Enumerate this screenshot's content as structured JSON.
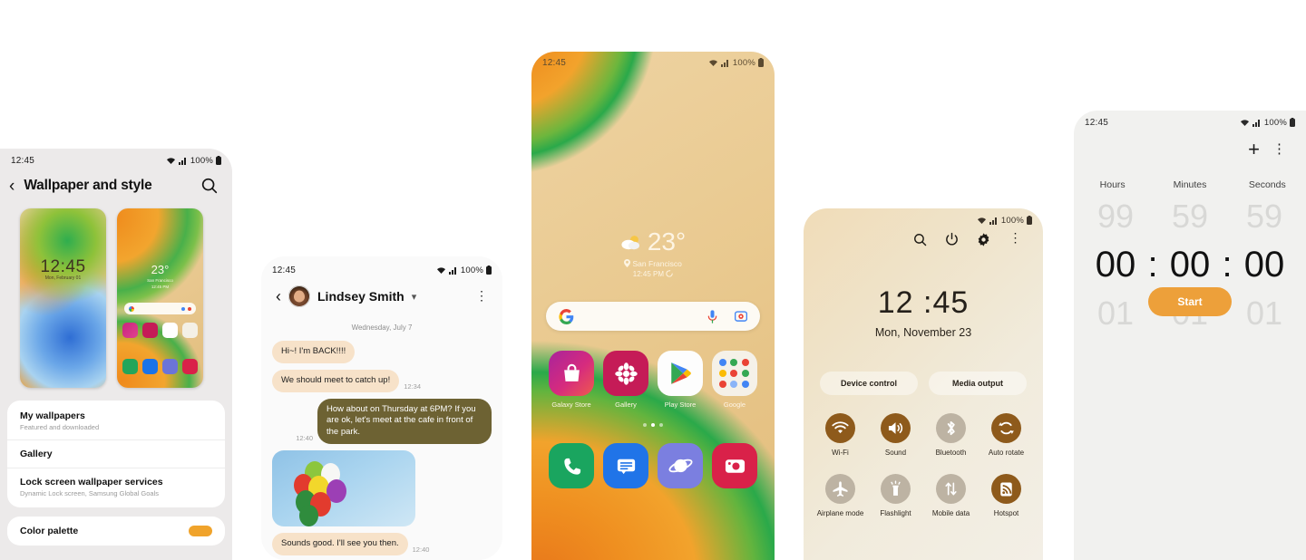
{
  "common": {
    "status_time": "12:45",
    "status_battery": "100%",
    "wifi_icon": "wifi-icon",
    "signal_icon": "signal-icon",
    "battery_icon": "battery-icon"
  },
  "panel_wallpaper": {
    "status_time": "12:45",
    "status_battery": "100%",
    "back_icon": "back-chevron-icon",
    "title": "Wallpaper and style",
    "search_icon": "search-icon",
    "previews": [
      {
        "name": "lock-screen-preview",
        "clock": "12:45",
        "date": "Mon, February 01"
      },
      {
        "name": "home-screen-preview",
        "temp": "23°",
        "city": "San Francisco",
        "time": "12:45 PM"
      }
    ],
    "list": [
      {
        "title": "My wallpapers",
        "subtitle": "Featured and downloaded"
      },
      {
        "title": "Gallery",
        "subtitle": ""
      },
      {
        "title": "Lock screen wallpaper services",
        "subtitle": "Dynamic Lock screen, Samsung Global Goals"
      }
    ],
    "palette_row": {
      "title": "Color palette",
      "chip_color": "#f0a32b"
    }
  },
  "panel_messages": {
    "status_time": "12:45",
    "status_battery": "100%",
    "back_icon": "back-chevron-icon",
    "contact_name": "Lindsey Smith",
    "chevron_icon": "chevron-down-icon",
    "kebab_icon": "more-options-icon",
    "day_divider": "Wednesday, July 7",
    "messages": [
      {
        "dir": "in",
        "text": "Hi~! I'm BACK!!!!",
        "time": ""
      },
      {
        "dir": "in",
        "text": "We should meet to catch up!",
        "time": "12:34"
      },
      {
        "dir": "out",
        "text": "How about on Thursday at 6PM? If you are ok, let's meet at the cafe in front of the park.",
        "time": "12:40"
      },
      {
        "dir": "in",
        "type": "image",
        "alt": "balloons-photo",
        "text": "",
        "time": ""
      },
      {
        "dir": "in",
        "text": "Sounds good. I'll see you then.",
        "time": "12:40"
      }
    ]
  },
  "panel_home": {
    "status_time": "12:45",
    "status_battery": "100%",
    "weather_temp": "23°",
    "weather_icon": "partly-cloudy-icon",
    "location_pin_icon": "location-pin-icon",
    "city": "San Francisco",
    "time_refresh": "12:45 PM",
    "refresh_icon": "refresh-icon",
    "search": {
      "google_icon": "google-g-icon",
      "mic_icon": "microphone-icon",
      "lens_icon": "google-lens-icon",
      "placeholder": ""
    },
    "apps": [
      {
        "label": "Galaxy Store",
        "icon": "galaxy-store-icon"
      },
      {
        "label": "Gallery",
        "icon": "gallery-icon"
      },
      {
        "label": "Play Store",
        "icon": "play-store-icon"
      },
      {
        "label": "Google",
        "icon": "google-folder-icon"
      }
    ],
    "page_dots": 3,
    "page_active": 2,
    "dock": [
      {
        "label": "Phone",
        "icon": "phone-icon"
      },
      {
        "label": "Messages",
        "icon": "messages-icon"
      },
      {
        "label": "Internet",
        "icon": "samsung-internet-icon"
      },
      {
        "label": "Camera",
        "icon": "camera-icon"
      }
    ]
  },
  "panel_quickpanel": {
    "status_battery": "100%",
    "icons": [
      "search-icon",
      "power-icon",
      "settings-gear-icon",
      "more-options-icon"
    ],
    "clock": "12 :45",
    "date": "Mon, November 23",
    "pills": [
      "Device control",
      "Media output"
    ],
    "toggles": [
      {
        "label": "Wi-Fi",
        "icon": "wifi-icon",
        "state": "on"
      },
      {
        "label": "Sound",
        "icon": "sound-icon",
        "state": "on"
      },
      {
        "label": "Bluetooth",
        "icon": "bluetooth-icon",
        "state": "off"
      },
      {
        "label": "Auto rotate",
        "icon": "auto-rotate-icon",
        "state": "on"
      },
      {
        "label": "Airplane mode",
        "icon": "airplane-icon",
        "state": "off"
      },
      {
        "label": "Flashlight",
        "icon": "flashlight-icon",
        "state": "off"
      },
      {
        "label": "Mobile data",
        "icon": "mobile-data-icon",
        "state": "off"
      },
      {
        "label": "Hotspot",
        "icon": "hotspot-icon",
        "state": "on"
      }
    ],
    "accent_on": "#8e5a1b",
    "accent_off": "#bdb3a3"
  },
  "panel_timer": {
    "status_time": "12:45",
    "status_battery": "100%",
    "add_icon": "plus-icon",
    "kebab_icon": "more-options-icon",
    "columns": [
      "Hours",
      "Minutes",
      "Seconds"
    ],
    "ghost_above": [
      "99",
      "59",
      "59"
    ],
    "selected": [
      "00",
      "00",
      "00"
    ],
    "ghost_below": [
      "01",
      "01",
      "01"
    ],
    "separator": ":",
    "start_label": "Start",
    "start_color": "#eda03a"
  }
}
